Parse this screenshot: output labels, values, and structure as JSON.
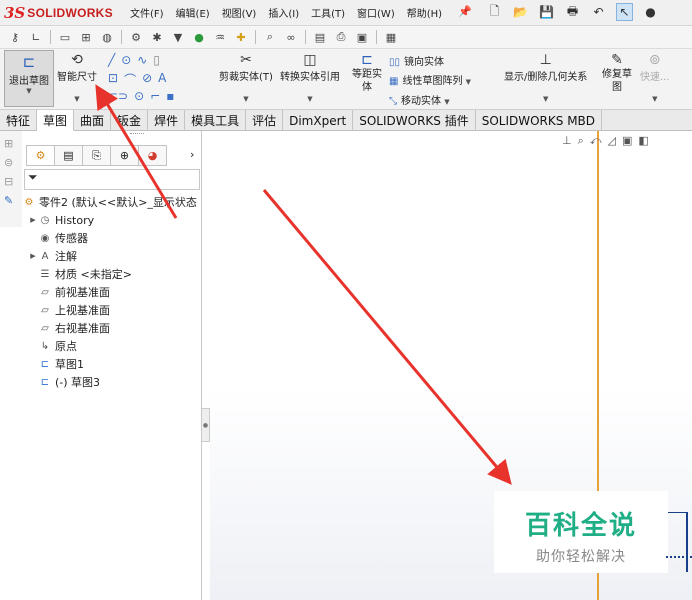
{
  "app": {
    "logo_ds": "3S",
    "logo_name": "SOLIDWORKS"
  },
  "menu": [
    "文件(F)",
    "编辑(E)",
    "视图(V)",
    "插入(I)",
    "工具(T)",
    "窗口(W)",
    "帮助(H)"
  ],
  "command_manager": {
    "exit_sketch": "退出草图",
    "smart_dimension": "智能尺寸",
    "trim": "剪裁实体(T)",
    "convert": "转换实体引用",
    "offset": "等距实体",
    "mirror": "镜向实体",
    "linear_pattern": "线性草图阵列",
    "move": "移动实体",
    "display_relations": "显示/删除几何关系",
    "repair": "修复草图",
    "quick_snap": "快速..."
  },
  "tabs": [
    "特征",
    "草图",
    "曲面",
    "钣金",
    "焊件",
    "模具工具",
    "评估",
    "DimXpert",
    "SOLIDWORKS 插件",
    "SOLIDWORKS MBD"
  ],
  "active_tab": "草图",
  "feature_tree": {
    "root": "零件2 (默认<<默认>_显示状态",
    "items": [
      {
        "label": "History",
        "icon": "history-icon",
        "expandable": true
      },
      {
        "label": "传感器",
        "icon": "sensor-icon",
        "expandable": false
      },
      {
        "label": "注解",
        "icon": "annotation-icon",
        "expandable": true
      },
      {
        "label": "材质 <未指定>",
        "icon": "material-icon",
        "expandable": false
      },
      {
        "label": "前视基准面",
        "icon": "plane-icon",
        "expandable": false
      },
      {
        "label": "上视基准面",
        "icon": "plane-icon",
        "expandable": false
      },
      {
        "label": "右视基准面",
        "icon": "plane-icon",
        "expandable": false
      },
      {
        "label": "原点",
        "icon": "origin-icon",
        "expandable": false
      },
      {
        "label": "草图1",
        "icon": "sketch-icon",
        "expandable": false
      },
      {
        "label": "(-) 草图3",
        "icon": "sketch-icon",
        "expandable": false
      }
    ]
  },
  "watermark": {
    "main": "百科全说",
    "sub": "助你轻松解决"
  },
  "colors": {
    "arrow": "#e8332c",
    "accent": "#2b6fd0",
    "watermark": "#1fae85",
    "origin_line": "#e6a33a"
  }
}
